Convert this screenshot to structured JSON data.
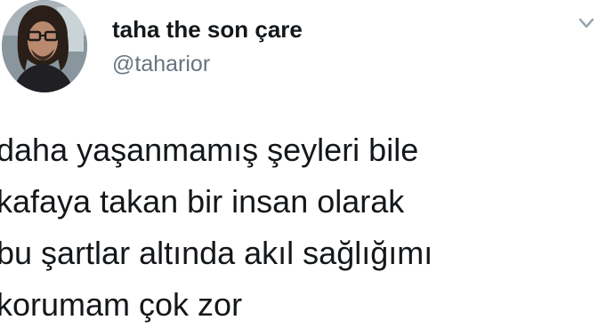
{
  "tweet": {
    "author": {
      "display_name": "taha the son çare",
      "handle": "@taharior"
    },
    "text_lines": [
      "daha yaşanmamış şeyleri bile",
      "kafaya takan bir insan olarak",
      "bu şartlar altında akıl sağlığımı",
      "korumam çok zor"
    ]
  },
  "icons": {
    "avatar": "user-avatar",
    "menu": "chevron-down-icon"
  },
  "colors": {
    "name": "#14171a",
    "handle": "#66757f",
    "background": "#ffffff"
  }
}
